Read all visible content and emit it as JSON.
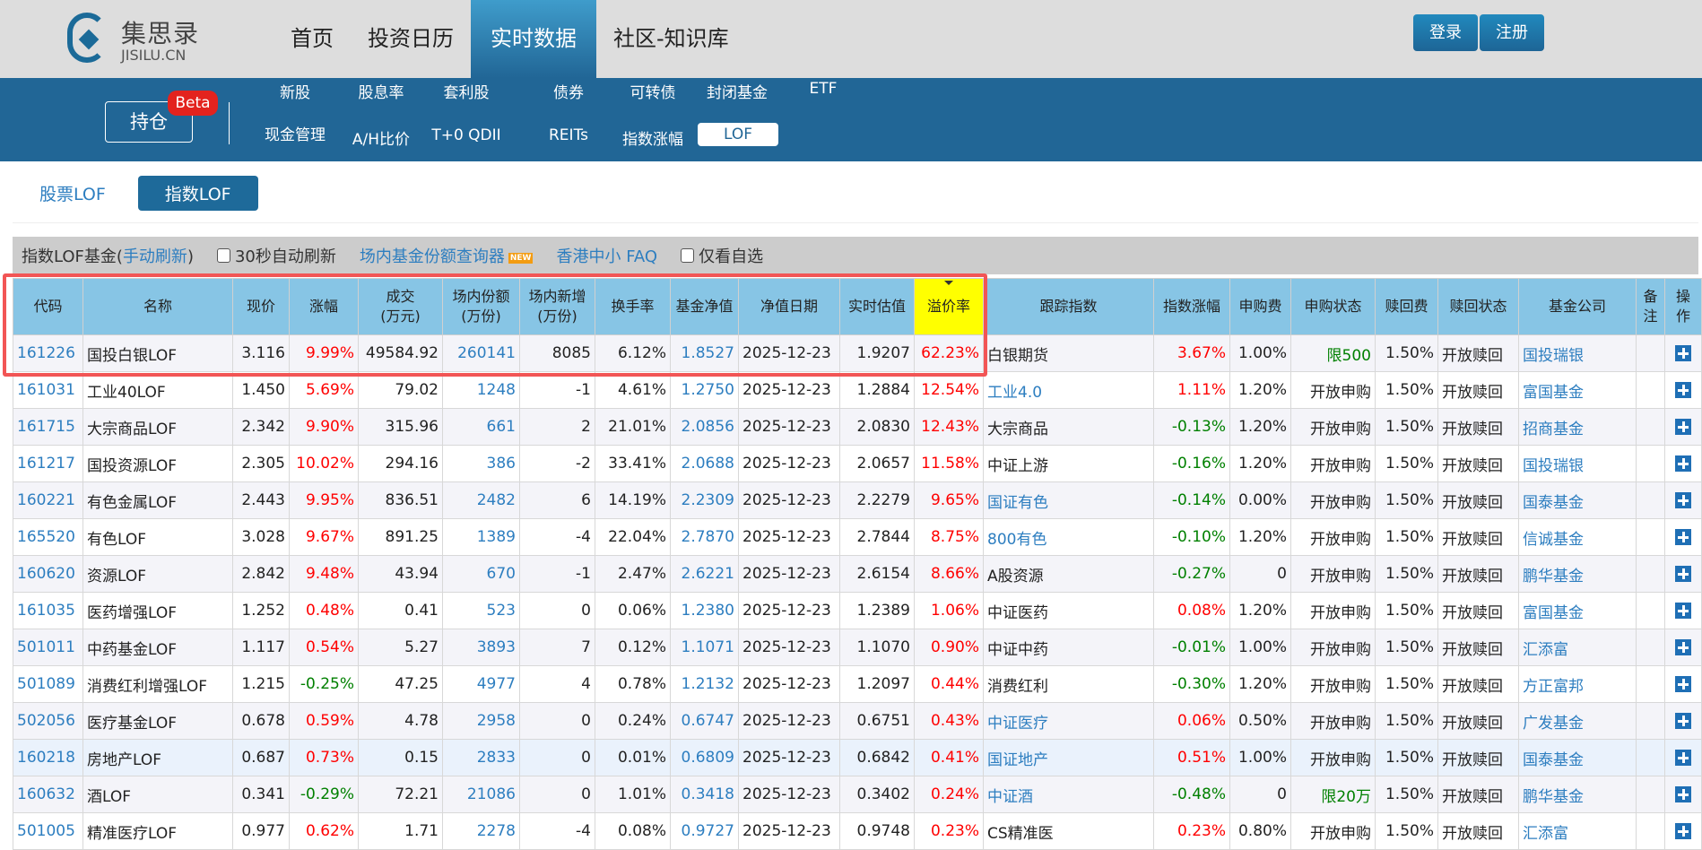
{
  "logo": {
    "cn": "集思录",
    "en": "JISILU.CN"
  },
  "nav": [
    {
      "label": "首页"
    },
    {
      "label": "投资日历"
    },
    {
      "label": "实时数据",
      "active": true
    },
    {
      "label": "社区-知识库"
    }
  ],
  "auth": {
    "login": "登录",
    "register": "注册"
  },
  "subnav": {
    "hold": "持仓",
    "beta": "Beta",
    "row1": [
      "新股",
      "股息率",
      "套利股",
      "债券",
      "可转债",
      "封闭基金",
      "ETF"
    ],
    "row2": [
      "现金管理",
      "A/H比价",
      "T+0 QDII",
      "REITs",
      "指数涨幅",
      "LOF"
    ]
  },
  "lof_tabs": [
    "股票LOF",
    "指数LOF"
  ],
  "toolbar": {
    "title": "指数LOF基金(",
    "refresh": "手动刷新",
    "close": ")",
    "auto": "30秒自动刷新",
    "query": "场内基金份额查询器",
    "new": "NEW",
    "faq": "香港中小 FAQ",
    "fav": "仅看自选"
  },
  "colors": {
    "up": "#ff0000",
    "down": "#008000",
    "link": "#2d7ec0",
    "header": "#87c5e5",
    "highlight": "#ffff00"
  },
  "columns": [
    "代码",
    "名称",
    "现价",
    "涨幅",
    "成交\n(万元)",
    "场内份额\n(万份)",
    "场内新增\n(万份)",
    "换手率",
    "基金净值",
    "净值日期",
    "实时估值",
    "溢价率",
    "跟踪指数",
    "指数涨幅",
    "申购费",
    "申购状态",
    "赎回费",
    "赎回状态",
    "基金公司",
    "备\n注",
    "操\n作"
  ],
  "rows": [
    [
      "161226",
      "国投白银LOF",
      "3.116",
      "9.99%",
      "49584.92",
      "260141",
      "8085",
      "6.12%",
      "1.8527",
      "2025-12-23",
      "1.9207",
      "62.23%",
      "白银期货",
      "3.67%",
      "1.00%",
      "限500",
      "1.50%",
      "开放赎回",
      "国投瑞银"
    ],
    [
      "161031",
      "工业40LOF",
      "1.450",
      "5.69%",
      "79.02",
      "1248",
      "-1",
      "4.61%",
      "1.2750",
      "2025-12-23",
      "1.2884",
      "12.54%",
      "工业4.0",
      "1.11%",
      "1.20%",
      "开放申购",
      "1.50%",
      "开放赎回",
      "富国基金"
    ],
    [
      "161715",
      "大宗商品LOF",
      "2.342",
      "9.90%",
      "315.96",
      "661",
      "2",
      "21.01%",
      "2.0856",
      "2025-12-23",
      "2.0830",
      "12.43%",
      "大宗商品",
      "-0.13%",
      "1.20%",
      "开放申购",
      "1.50%",
      "开放赎回",
      "招商基金"
    ],
    [
      "161217",
      "国投资源LOF",
      "2.305",
      "10.02%",
      "294.16",
      "386",
      "-2",
      "33.41%",
      "2.0688",
      "2025-12-23",
      "2.0657",
      "11.58%",
      "中证上游",
      "-0.16%",
      "1.20%",
      "开放申购",
      "1.50%",
      "开放赎回",
      "国投瑞银"
    ],
    [
      "160221",
      "有色金属LOF",
      "2.443",
      "9.95%",
      "836.51",
      "2482",
      "6",
      "14.19%",
      "2.2309",
      "2025-12-23",
      "2.2279",
      "9.65%",
      "国证有色",
      "-0.14%",
      "0.00%",
      "开放申购",
      "1.50%",
      "开放赎回",
      "国泰基金"
    ],
    [
      "165520",
      "有色LOF",
      "3.028",
      "9.67%",
      "891.25",
      "1389",
      "-4",
      "22.04%",
      "2.7870",
      "2025-12-23",
      "2.7844",
      "8.75%",
      "800有色",
      "-0.10%",
      "1.20%",
      "开放申购",
      "1.50%",
      "开放赎回",
      "信诚基金"
    ],
    [
      "160620",
      "资源LOF",
      "2.842",
      "9.48%",
      "43.94",
      "670",
      "-1",
      "2.47%",
      "2.6221",
      "2025-12-23",
      "2.6154",
      "8.66%",
      "A股资源",
      "-0.27%",
      "0",
      "开放申购",
      "1.50%",
      "开放赎回",
      "鹏华基金"
    ],
    [
      "161035",
      "医药增强LOF",
      "1.252",
      "0.48%",
      "0.41",
      "523",
      "0",
      "0.06%",
      "1.2380",
      "2025-12-23",
      "1.2389",
      "1.06%",
      "中证医药",
      "0.08%",
      "1.20%",
      "开放申购",
      "1.50%",
      "开放赎回",
      "富国基金"
    ],
    [
      "501011",
      "中药基金LOF",
      "1.117",
      "0.54%",
      "5.27",
      "3893",
      "7",
      "0.12%",
      "1.1071",
      "2025-12-23",
      "1.1070",
      "0.90%",
      "中证中药",
      "-0.01%",
      "1.00%",
      "开放申购",
      "1.50%",
      "开放赎回",
      "汇添富"
    ],
    [
      "501089",
      "消费红利增强LOF",
      "1.215",
      "-0.25%",
      "47.25",
      "4977",
      "4",
      "0.78%",
      "1.2132",
      "2025-12-23",
      "1.2097",
      "0.44%",
      "消费红利",
      "-0.30%",
      "1.20%",
      "开放申购",
      "1.50%",
      "开放赎回",
      "方正富邦"
    ],
    [
      "502056",
      "医疗基金LOF",
      "0.678",
      "0.59%",
      "4.78",
      "2958",
      "0",
      "0.24%",
      "0.6747",
      "2025-12-23",
      "0.6751",
      "0.43%",
      "中证医疗",
      "0.06%",
      "0.50%",
      "开放申购",
      "1.50%",
      "开放赎回",
      "广发基金"
    ],
    [
      "160218",
      "房地产LOF",
      "0.687",
      "0.73%",
      "0.15",
      "2833",
      "0",
      "0.01%",
      "0.6809",
      "2025-12-23",
      "0.6842",
      "0.41%",
      "国证地产",
      "0.51%",
      "1.00%",
      "开放申购",
      "1.50%",
      "开放赎回",
      "国泰基金"
    ],
    [
      "160632",
      "酒LOF",
      "0.341",
      "-0.29%",
      "72.21",
      "21086",
      "0",
      "1.01%",
      "0.3418",
      "2025-12-23",
      "0.3402",
      "0.24%",
      "中证酒",
      "-0.48%",
      "0",
      "限20万",
      "1.50%",
      "开放赎回",
      "鹏华基金"
    ],
    [
      "501005",
      "精准医疗LOF",
      "0.977",
      "0.62%",
      "1.71",
      "2278",
      "-4",
      "0.08%",
      "0.9727",
      "2025-12-23",
      "0.9748",
      "0.23%",
      "CS精准医",
      "0.23%",
      "0.80%",
      "开放申购",
      "1.50%",
      "开放赎回",
      "汇添富"
    ]
  ],
  "index_links": [
    "工业4.0",
    "国证有色",
    "800有色",
    "中证医疗",
    "国证地产",
    "中证酒"
  ],
  "selected_row": "160218"
}
